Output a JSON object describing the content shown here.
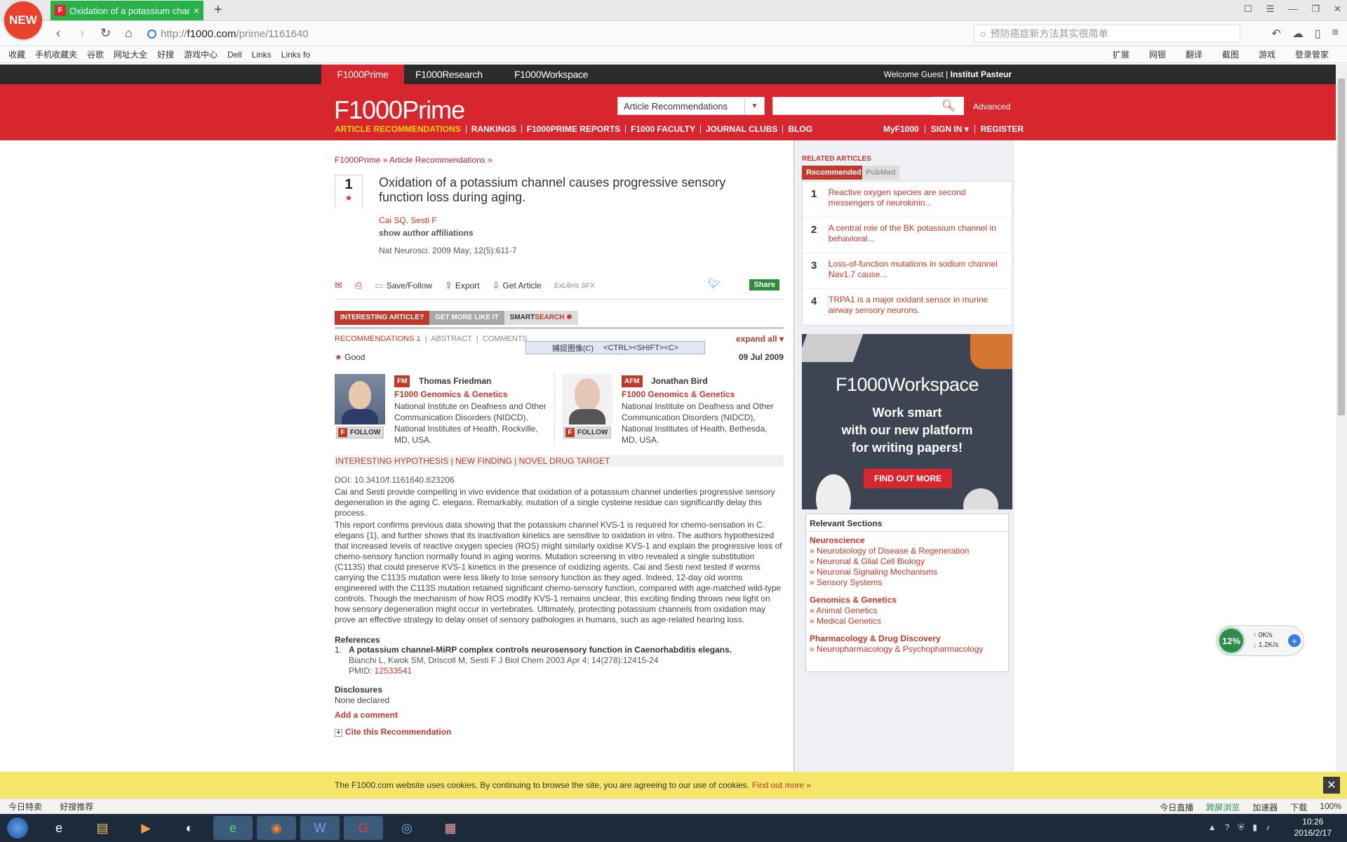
{
  "browser": {
    "new_badge": "NEW",
    "tab_title": "Oxidation of a potassium char",
    "tab_icon": "F",
    "tab_close": "×",
    "new_tab": "+",
    "url_prefix": "http://",
    "url_domain": "f1000.com",
    "url_path": "/prime/1161640",
    "search_placeholder": "预防癌症新方法其实很简单",
    "favorites": [
      "收藏",
      "手机收藏夹",
      "谷歌",
      "网址大全",
      "好搜",
      "游戏中心",
      "Dell",
      "Links",
      "Links fo"
    ],
    "fav_right": [
      "扩展",
      "网银",
      "翻译",
      "截图",
      "游戏",
      "登录管家"
    ]
  },
  "site": {
    "products": [
      "F1000Prime",
      "F1000Research",
      "F1000Workspace"
    ],
    "welcome_guest": "Welcome Guest | ",
    "welcome_inst": "Institut Pasteur",
    "logo": "F1000Prime",
    "select_value": "Article Recommendations",
    "advanced": "Advanced",
    "main_nav": [
      "ARTICLE RECOMMENDATIONS",
      "RANKINGS",
      "F1000PRIME REPORTS",
      "F1000 FACULTY",
      "JOURNAL CLUBS",
      "BLOG"
    ],
    "user_nav": [
      "MyF1000",
      "SIGN IN ▾",
      "REGISTER"
    ]
  },
  "article": {
    "breadcrumb": "F1000Prime » Article Recommendations »",
    "score": "1",
    "title": "Oxidation of a potassium channel causes progressive sensory function loss during aging.",
    "authors": "Cai SQ, Sesti F",
    "show_aff": "show author affiliations",
    "journal": "Nat Neurosci. 2009 May; 12(5):611-7",
    "actions": [
      "Save/Follow",
      "Export",
      "Get Article"
    ],
    "exlibris": "ExLibris SFX",
    "share": "Share",
    "smart1": "INTERESTING ARTICLE?",
    "smart2": "GET MORE LIKE IT",
    "smart3a": "SMART",
    "smart3b": "SEARCH",
    "tab_recs": "RECOMMENDATIONS 1",
    "tab_abstract": "ABSTRACT",
    "tab_comments": "COMMENTS",
    "expand_all": "expand all",
    "tooltip_a": "捕捉图像(C)",
    "tooltip_b": "<CTRL><SHIFT><C>",
    "rating": "Good",
    "rating_date": "09 Jul 2009",
    "faculty": [
      {
        "badge": "FM",
        "name": "Thomas Friedman",
        "section": "F1000 Genomics & Genetics",
        "inst": "National Institute on Deafness and Other Communication Disorders (NIDCD), National Institutes of Health, Rockville, MD, USA.",
        "follow": "FOLLOW"
      },
      {
        "badge": "AFM",
        "name": "Jonathan Bird",
        "section": "F1000 Genomics & Genetics",
        "inst": "National Institute on Deafness and Other Communication Disorders (NIDCD), National Institutes of Health, Bethesda, MD, USA.",
        "follow": "FOLLOW"
      }
    ],
    "tags": "INTERESTING HYPOTHESIS | NEW FINDING | NOVEL DRUG TARGET",
    "doi": "DOI: 10.3410/f.1161640.623206",
    "para1": "Cai and Sesti provide compelling in vivo evidence that oxidation of a potassium channel underlies progressive sensory degeneration in the aging C. elegans. Remarkably, mutation of a single cysteine residue can significantly delay this process.",
    "para2": "This report confirms previous data showing that the potassium channel KVS-1 is required for chemo-sensation in C. elegans {1}, and further shows that its inactivation kinetics are sensitive to oxidation in vitro. The authors hypothesized that increased levels of reactive oxygen species (ROS) might similarly oxidise KVS-1 and explain the progressive loss of chemo-sensory function normally found in aging worms. Mutation screening in vitro revealed a single substitution (C113S) that could preserve KVS-1 kinetics in the presence of oxidizing agents. Cai and Sesti next tested if worms carrying the C113S mutation were less likely to lose sensory function as they aged. Indeed, 12-day old worms engineered with the C113S mutation retained significant chemo-sensory function, compared with age-matched wild-type controls. Though the mechanism of how ROS modify KVS-1 remains unclear, this exciting finding throws new light on how sensory degeneration might occur in vertebrates. Ultimately, protecting potassium channels from oxidation may prove an effective strategy to delay onset of sensory pathologies in humans, such as age-related hearing loss.",
    "refs_heading": "References",
    "ref1_num": "1.",
    "ref1_title": "A potassium channel-MiRP complex controls neurosensory function in Caenorhabditis elegans.",
    "ref1_auth": "Bianchi L, Kwok SM, Driscoll M, Sesti F J Biol Chem 2003 Apr 4; 14(278):12415-24",
    "pmid_label": "PMID: ",
    "pmid": "12533541",
    "disc_heading": "Disclosures",
    "disc_text": "None declared",
    "add_comment": "Add a comment",
    "cite": "Cite this Recommendation"
  },
  "sidebar": {
    "related_heading": "RELATED ARTICLES",
    "tab_recommended": "Recommended",
    "tab_pubmed": "PubMed",
    "related": [
      {
        "n": "1",
        "t": "Reactive oxygen species are second messengers of neurokinin..."
      },
      {
        "n": "2",
        "t": "A central role of the BK potassium channel in behavioral..."
      },
      {
        "n": "3",
        "t": "Loss-of-function mutations in sodium channel Nav1.7 cause..."
      },
      {
        "n": "4",
        "t": "TRPA1 is a major oxidant sensor in murine airway sensory neurons."
      }
    ],
    "ad_logo": "F1000Workspace",
    "ad_line1": "Work smart",
    "ad_line2": "with our new platform",
    "ad_line3": "for writing papers!",
    "ad_button": "FIND OUT MORE",
    "relsec_heading": "Relevant Sections",
    "groups": [
      {
        "name": "Neuroscience",
        "items": [
          "» Neurobiology of Disease & Regeneration",
          "» Neuronal & Glial Cell Biology",
          "» Neuronal Signaling Mechanisms",
          "» Sensory Systems"
        ]
      },
      {
        "name": "Genomics & Genetics",
        "items": [
          "» Animal Genetics",
          "» Medical Genetics"
        ]
      },
      {
        "name": "Pharmacology & Drug Discovery",
        "items": [
          "» Neuropharmacology & Psychopharmacology"
        ]
      }
    ]
  },
  "net_widget": {
    "percent": "12%",
    "up": "0K/s",
    "down": "1.2K/s"
  },
  "cookie": {
    "text": "The F1000.com website uses cookies. By continuing to browse the site, you are agreeing to our use of cookies.",
    "link": "Find out more »"
  },
  "statusbar": {
    "left1": "今日特卖",
    "left2": "好搜推荐",
    "right": [
      "今日直播",
      "跨屏浏览",
      "加速器",
      "下载",
      "100%"
    ]
  },
  "clock": {
    "time": "10:26",
    "date": "2016/2/17"
  }
}
